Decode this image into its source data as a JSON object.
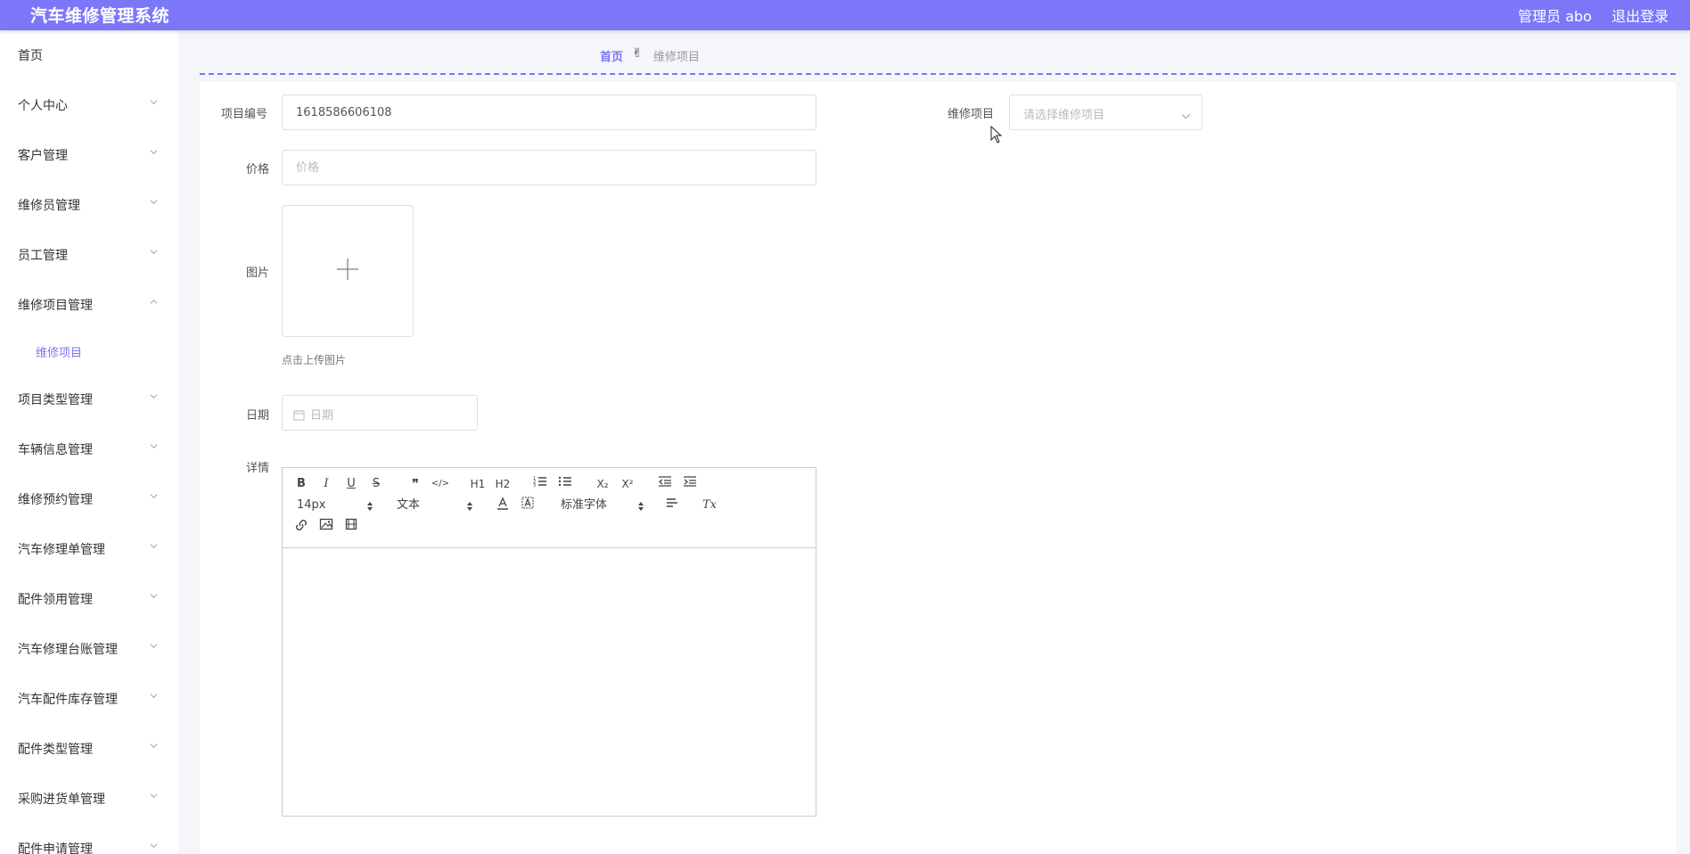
{
  "app": {
    "title": "汽车维修管理系统",
    "user": "管理员 abo",
    "logout": "退出登录"
  },
  "sidebar": {
    "items": [
      {
        "label": "首页"
      },
      {
        "label": "个人中心"
      },
      {
        "label": "客户管理"
      },
      {
        "label": "维修员管理"
      },
      {
        "label": "员工管理"
      },
      {
        "label": "维修项目管理"
      },
      {
        "label": "项目类型管理"
      },
      {
        "label": "车辆信息管理"
      },
      {
        "label": "维修预约管理"
      },
      {
        "label": "汽车修理单管理"
      },
      {
        "label": "配件领用管理"
      },
      {
        "label": "汽车修理台账管理"
      },
      {
        "label": "汽车配件库存管理"
      },
      {
        "label": "配件类型管理"
      },
      {
        "label": "采购进货单管理"
      },
      {
        "label": "配件申请管理"
      }
    ],
    "sub_item": {
      "label": "维修项目"
    }
  },
  "breadcrumb": {
    "home": "首页",
    "sep": "✌",
    "current": "维修项目"
  },
  "form": {
    "code_label": "项目编号",
    "code_value": "1618586606108",
    "project_label": "维修项目",
    "project_placeholder": "请选择维修项目",
    "price_label": "价格",
    "price_placeholder": "价格",
    "image_label": "图片",
    "upload_hint": "点击上传图片",
    "date_label": "日期",
    "date_placeholder": "日期",
    "detail_label": "详情"
  },
  "editor": {
    "buttons": {
      "bold": "B",
      "italic": "I",
      "underline": "U",
      "strike": "S",
      "quote": "❞",
      "code": "</>",
      "h1": "H1",
      "h2": "H2",
      "sub": "X₂",
      "sup": "X²",
      "clean": "Tx"
    },
    "size_value": "14px",
    "header_value": "文本",
    "font_value": "标准字体"
  }
}
